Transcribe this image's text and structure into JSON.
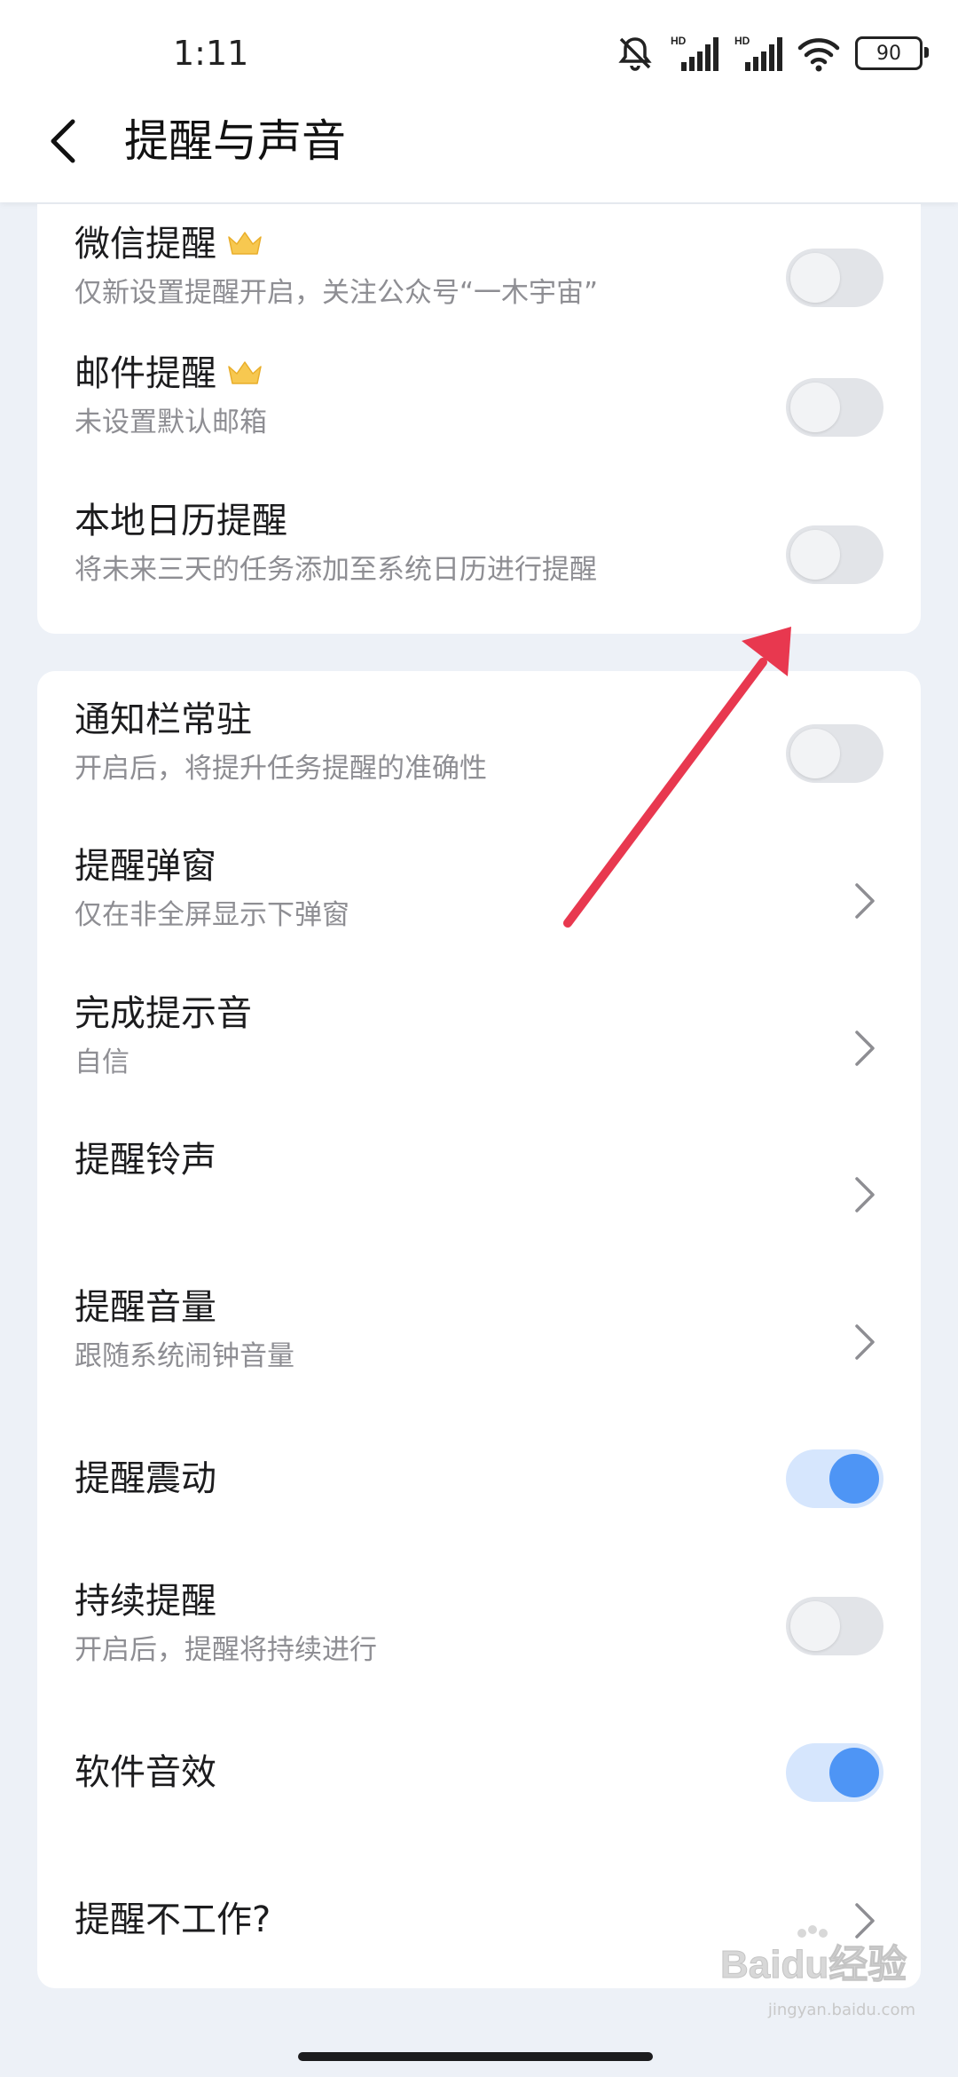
{
  "status_bar": {
    "time": "1:11",
    "battery": "90",
    "signal_tag_1": "HD",
    "signal_tag_2": "HD"
  },
  "header": {
    "title": "提醒与声音"
  },
  "card1": [
    {
      "title": "微信提醒",
      "subtitle": "仅新设置提醒开启，关注公众号“一木宇宙”",
      "premium": true,
      "control": "toggle",
      "on": false
    },
    {
      "title": "邮件提醒",
      "subtitle": "未设置默认邮箱",
      "premium": true,
      "control": "toggle",
      "on": false
    },
    {
      "title": "本地日历提醒",
      "subtitle": "将未来三天的任务添加至系统日历进行提醒",
      "premium": false,
      "control": "toggle",
      "on": false
    }
  ],
  "card2": [
    {
      "title": "通知栏常驻",
      "subtitle": "开启后，将提升任务提醒的准确性",
      "control": "toggle",
      "on": false
    },
    {
      "title": "提醒弹窗",
      "subtitle": "仅在非全屏显示下弹窗",
      "control": "chevron"
    },
    {
      "title": "完成提示音",
      "subtitle": "自信",
      "control": "chevron"
    },
    {
      "title": "提醒铃声",
      "subtitle": "",
      "control": "chevron"
    },
    {
      "title": "提醒音量",
      "subtitle": "跟随系统闹钟音量",
      "control": "chevron"
    },
    {
      "title": "提醒震动",
      "subtitle": "",
      "control": "toggle",
      "on": true
    },
    {
      "title": "持续提醒",
      "subtitle": "开启后，提醒将持续进行",
      "control": "toggle",
      "on": false
    },
    {
      "title": "软件音效",
      "subtitle": "",
      "control": "toggle",
      "on": true
    },
    {
      "title": "提醒不工作?",
      "subtitle": "",
      "control": "chevron"
    }
  ],
  "watermark": {
    "brand": "Baidu经验",
    "url": "jingyan.baidu.com"
  },
  "colors": {
    "toggle_on_track": "#D6E6FD",
    "toggle_on_knob": "#4E95F5",
    "toggle_off_track": "#E2E4E8",
    "annotation_arrow": "#E8384F",
    "background": "#EDF1F7"
  }
}
